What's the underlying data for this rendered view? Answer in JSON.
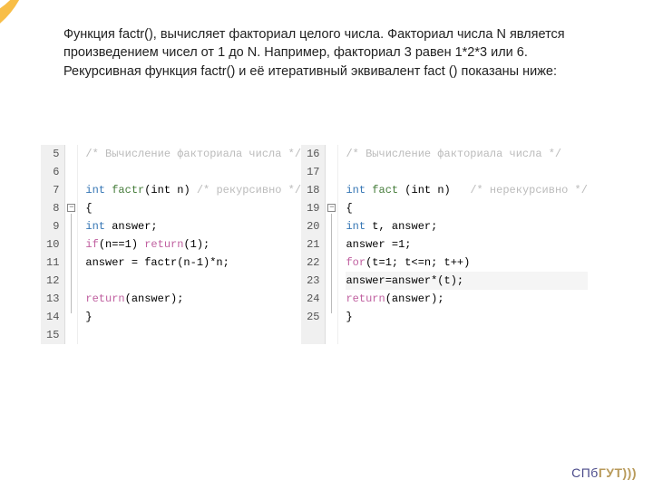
{
  "paragraph": "Функция factr(), вычисляет факториал целого числа. Факториал числа N является произведением чисел от 1 до N. Например, факториал 3 равен 1*2*3 или 6. Рекурсивная функция  factr() и её итеративный эквивалент fact () показаны ниже:",
  "left_code": {
    "lines": [
      "5",
      "6",
      "7",
      "8",
      "9",
      "10",
      "11",
      "12",
      "13",
      "14",
      "15"
    ],
    "src": [
      {
        "t": "comment",
        "text": "/* Вычисление факториала числа */"
      },
      {
        "t": "blank",
        "text": ""
      },
      {
        "t": "sig",
        "kw": "int",
        "fn": "factr",
        "args": "(int n)",
        "cmt": " /* рекурсивно */"
      },
      {
        "t": "plain",
        "text": "{"
      },
      {
        "t": "decl",
        "kw": "int",
        "rest": " answer;"
      },
      {
        "t": "if",
        "kw1": "if",
        "cond": "(n==1) ",
        "kw2": "return",
        "rest": "(1);"
      },
      {
        "t": "plain",
        "text": "answer = factr(n-1)*n;"
      },
      {
        "t": "blank",
        "text": ""
      },
      {
        "t": "ret",
        "kw": "return",
        "rest": "(answer);"
      },
      {
        "t": "plain",
        "text": "}"
      },
      {
        "t": "blank",
        "text": ""
      }
    ]
  },
  "right_code": {
    "lines": [
      "16",
      "17",
      "18",
      "19",
      "20",
      "21",
      "22",
      "23",
      "24",
      "25"
    ],
    "src": [
      {
        "t": "comment",
        "text": "/* Вычисление факториала числа */"
      },
      {
        "t": "blank",
        "text": ""
      },
      {
        "t": "sig2",
        "kw": "int",
        "fn": "fact",
        "args": " (int n)   ",
        "cmt": "/* нерекурсивно */"
      },
      {
        "t": "plain",
        "text": "{"
      },
      {
        "t": "decl",
        "kw": "int",
        "rest": " t, answer;"
      },
      {
        "t": "plain",
        "text": "answer =1;"
      },
      {
        "t": "for",
        "kw": "for",
        "rest": "(t=1; t<=n; t++)"
      },
      {
        "t": "hl",
        "text": "answer=answer*(t);"
      },
      {
        "t": "ret",
        "kw": "return",
        "rest": "(answer);"
      },
      {
        "t": "plain",
        "text": "}"
      }
    ]
  },
  "logo": {
    "left": "СПб",
    "right": "ГУТ)))"
  }
}
